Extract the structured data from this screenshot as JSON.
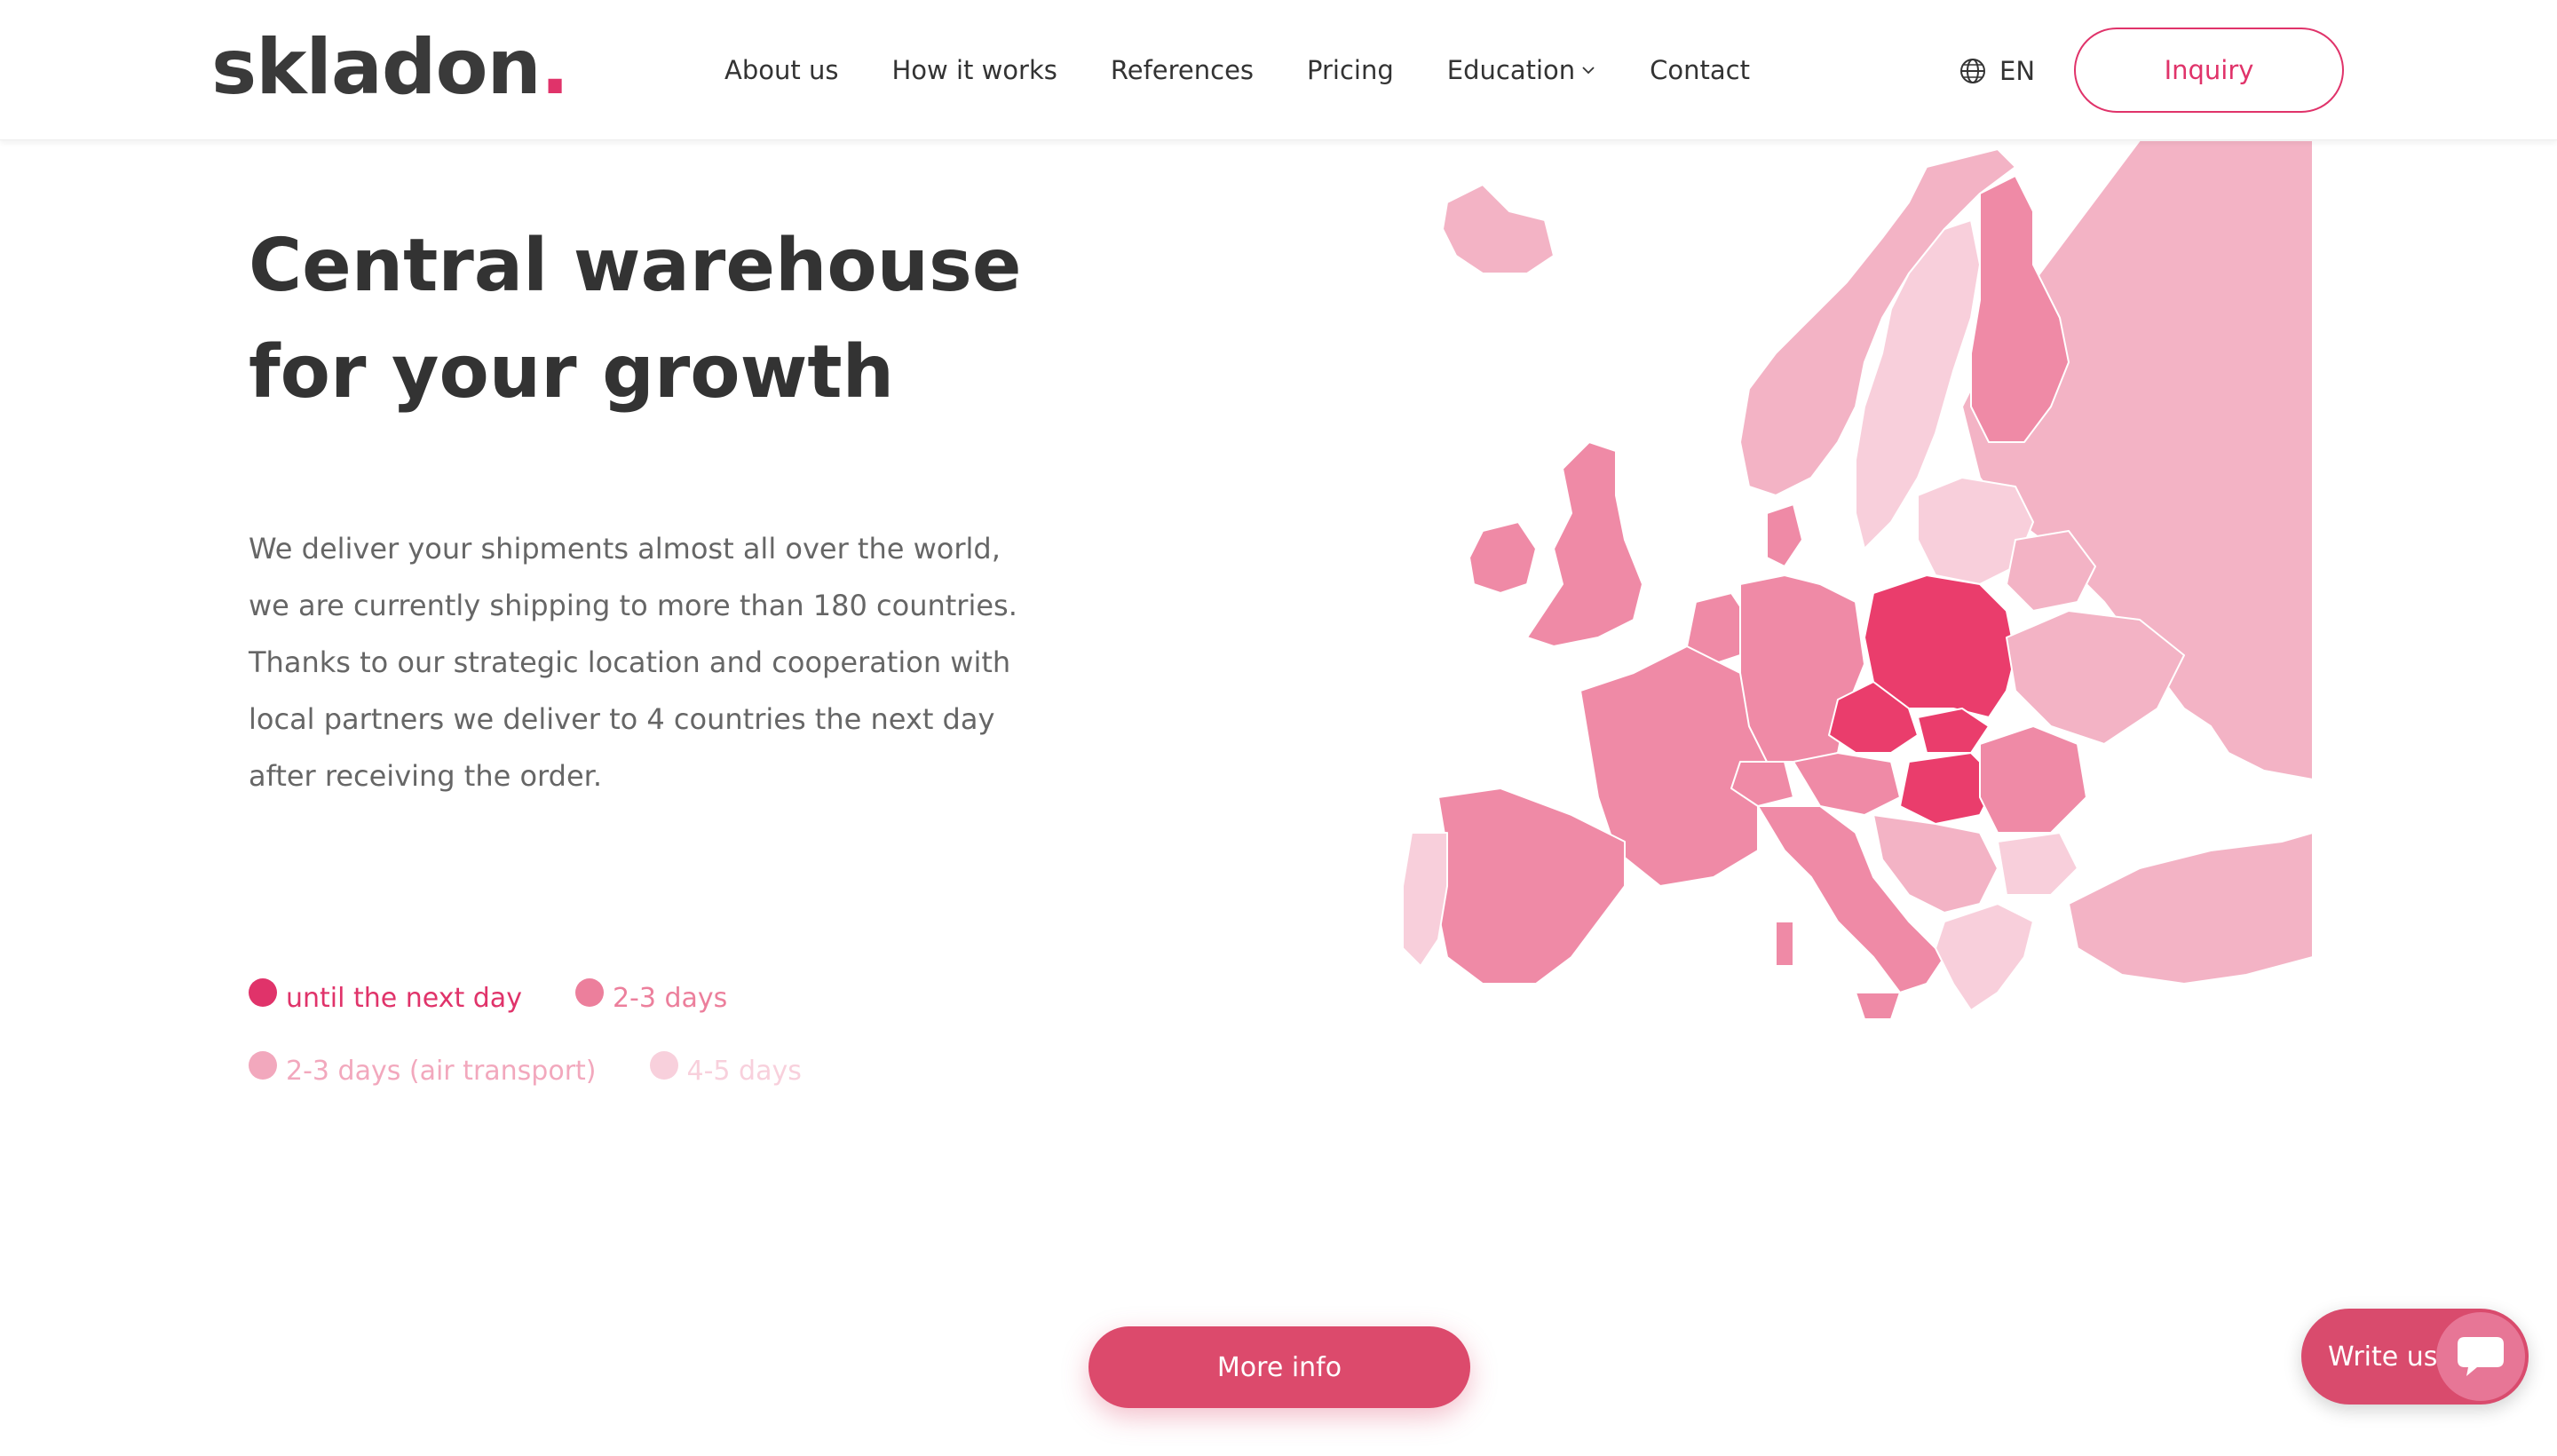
{
  "header": {
    "logo_text": "skladon",
    "logo_dot": ".",
    "nav": [
      {
        "label": "About us"
      },
      {
        "label": "How it works"
      },
      {
        "label": "References"
      },
      {
        "label": "Pricing"
      },
      {
        "label": "Education",
        "has_dropdown": true
      },
      {
        "label": "Contact"
      }
    ],
    "language": "EN",
    "inquiry_label": "Inquiry"
  },
  "hero": {
    "title_line1": "Central warehouse",
    "title_line2": "for your growth",
    "description": "We deliver your shipments almost all over the world, we are currently shipping to more than 180 countries. Thanks to our strategic location and cooperation with local partners we deliver to 4 countries the next day after receiving the order."
  },
  "legend": [
    {
      "label": "until the next day",
      "color": "#e0336a"
    },
    {
      "label": "2-3 days",
      "color": "#ec7f9c"
    },
    {
      "label": "2-3 days (air transport)",
      "color": "#f2a8bd"
    },
    {
      "label": "4-5 days",
      "color": "#f8d0dc"
    }
  ],
  "map": {
    "colors": {
      "next_day": "#ea3d6c",
      "two_three": "#ef8aa6",
      "air": "#f3b3c5",
      "four_five": "#f8cfdb",
      "border": "#ffffff"
    }
  },
  "actions": {
    "more_info_label": "More info",
    "write_us_label": "Write us"
  },
  "icons": {
    "globe": "globe-icon",
    "chevron": "chevron-down-icon",
    "chat": "chat-bubble-icon"
  }
}
